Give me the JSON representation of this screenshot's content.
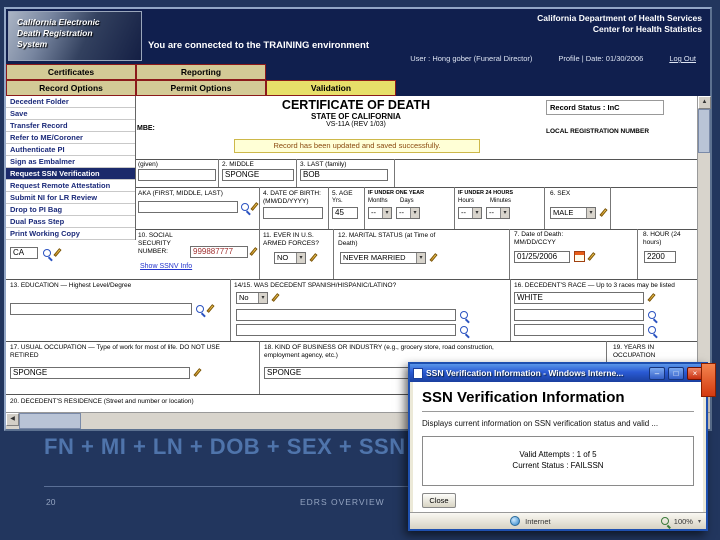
{
  "slide": {
    "caption": "FN + MI + LN + DOB + SEX + SSN",
    "page_number": "20",
    "footer_title": "EDRS OVERVIEW"
  },
  "app": {
    "logo": {
      "line1": "California Electronic",
      "line2": "Death Registration",
      "line3": "System"
    },
    "header": {
      "dept_line1": "California Department of Health Services",
      "dept_line2": "Center for Health Statistics",
      "training_banner": "You are connected to the TRAINING environment",
      "user_info": "User : Hong gober (Funeral Director)",
      "profile_date": "Profile | Date: 01/30/2006",
      "logout_label": "Log Out"
    },
    "menu_row1": [
      {
        "label": "Certificates"
      },
      {
        "label": "Reporting"
      }
    ],
    "menu_row2": [
      {
        "label": "Record Options"
      },
      {
        "label": "Permit Options"
      },
      {
        "label": "Validation"
      }
    ],
    "sidebar": {
      "items": [
        {
          "label": "Decedent Folder"
        },
        {
          "label": "Save"
        },
        {
          "label": "Transfer Record"
        },
        {
          "label": "Refer to ME/Coroner"
        },
        {
          "label": "Authenticate PI"
        },
        {
          "label": "Sign as Embalmer"
        },
        {
          "label": "Request SSN Verification"
        },
        {
          "label": "Request Remote Attestation"
        },
        {
          "label": "Submit NI for LR Review"
        },
        {
          "label": "Drop to PI Bag"
        },
        {
          "label": "Dual Pass Step"
        },
        {
          "label": "Print Working Copy"
        }
      ]
    },
    "form": {
      "title": "CERTIFICATE OF DEATH",
      "subtitle": "STATE OF CALIFORNIA",
      "revision": "VS-11A (REV 1/03)",
      "record_status": "Record Status : InC",
      "local_reg_label": "LOCAL REGISTRATION NUMBER",
      "cert_no_label": "MBE:",
      "save_message": "Record has been updated and saved successfully.",
      "f1_label": "(given)",
      "f2_label": "2. MIDDLE",
      "f2_value": "SPONGE",
      "f3_label": "3. LAST (family)",
      "f3_value": "BOB",
      "aka_label": "AKA (FIRST, MIDDLE, LAST)",
      "f4_label": "4. DATE OF BIRTH:(MM/DD/YYYY)",
      "f5_label": "5. AGE",
      "f5_unit": "Yrs.",
      "f5_value": "45",
      "under_year_title": "IF UNDER ONE YEAR",
      "months_label": "Months",
      "days_label": "Days",
      "under_24_title": "IF UNDER 24 HOURS",
      "hours_label": "Hours",
      "minutes_label": "Minutes",
      "empty_select": "--",
      "f6_label": "6. SEX",
      "f6_value": "MALE",
      "f9_value": "CA",
      "f10_label_1": "10. SOCIAL SECURITY",
      "f10_label_2": "NUMBER:",
      "f10_value": "999887777",
      "ssnv_link": "Show SSNV Info",
      "f11_label": "11. EVER IN U.S. ARMED FORCES?",
      "f11_value": "NO",
      "f12_label": "12. MARITAL STATUS (at Time of Death)",
      "f12_value": "NEVER MARRIED",
      "f7_label_1": "7. Date of Death:",
      "f7_label_2": "MM/DD/CCYY",
      "f7_value": "01/25/2006",
      "f8_label_1": "8. HOUR (24",
      "f8_label_2": "hours)",
      "f8_value": "2200",
      "f13_label": "13. EDUCATION — Highest Level/Degree",
      "f1415_label": "14/15. WAS DECEDENT SPANISH/HISPANIC/LATINO?",
      "f1415_value": "No",
      "f16_label": "16. DECEDENT'S RACE — Up to 3 races may be listed",
      "f16_value": "WHITE",
      "f17_label": "17. USUAL OCCUPATION — Type of work for most of life. DO NOT USE RETIRED",
      "f17_value": "SPONGE",
      "f18_label": "18. KIND OF BUSINESS OR INDUSTRY (e.g., grocery store, road construction, employment agency, etc.)",
      "f18_value": "SPONGE",
      "f19_label": "19. YEARS IN OCCUPATION",
      "f20_label": "20. DECEDENT'S RESIDENCE (Street and number or location)"
    }
  },
  "popup": {
    "window_title": "SSN Verification Information - Windows Interne...",
    "minimize_label": "–",
    "maximize_label": "□",
    "close_x_label": "×",
    "heading": "SSN Verification Information",
    "description": "Displays current information on SSN verification status and valid ...",
    "valid_attempts": "Valid Attempts : 1 of 5",
    "current_status": "Current Status : FAILSSN",
    "close_label": "Close",
    "status_zone": "Internet",
    "zoom_level": "100%"
  }
}
